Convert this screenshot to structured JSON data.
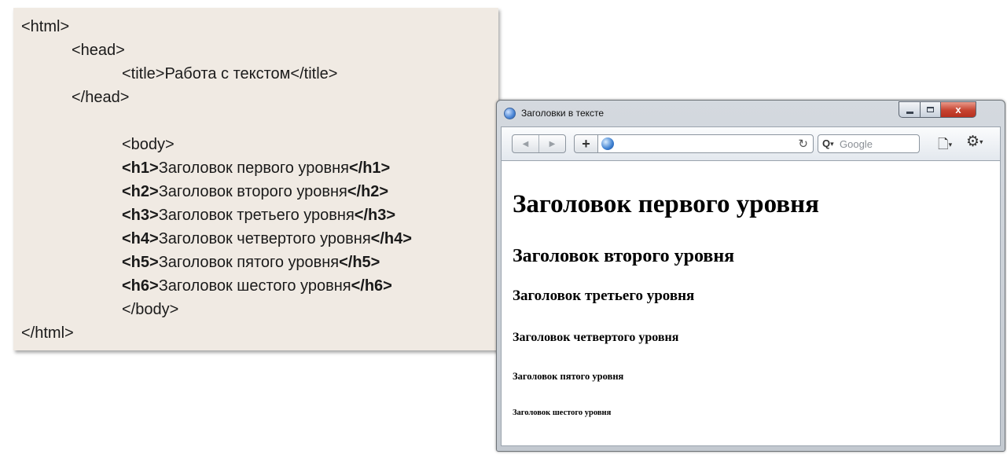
{
  "code_lines": [
    {
      "indent": 0,
      "plain": "<html>"
    },
    {
      "indent": 1,
      "plain": "<head>"
    },
    {
      "indent": 2,
      "plain": "<title>Работа с текстом</title>"
    },
    {
      "indent": 1,
      "plain": "</head>"
    },
    {
      "indent": 2,
      "plain": "<body>"
    },
    {
      "indent": 2,
      "open": "<h1>",
      "text": "Заголовок первого уровня",
      "close": "</h1>"
    },
    {
      "indent": 2,
      "open": "<h2>",
      "text": "Заголовок второго уровня",
      "close": "</h2>"
    },
    {
      "indent": 2,
      "open": "<h3>",
      "text": "Заголовок третьего уровня",
      "close": "</h3>"
    },
    {
      "indent": 2,
      "open": "<h4>",
      "text": "Заголовок четвертого уровня",
      "close": "</h4>"
    },
    {
      "indent": 2,
      "open": "<h5>",
      "text": "Заголовок пятого уровня",
      "close": "</h5>"
    },
    {
      "indent": 2,
      "open": "<h6>",
      "text": "Заголовок шестого уровня",
      "close": "</h6>"
    },
    {
      "indent": 2,
      "plain": "</body>"
    },
    {
      "indent": 0,
      "plain": "</html>"
    }
  ],
  "browser": {
    "title": "Заголовки в тексте",
    "back_icon": "◀",
    "forward_icon": "▶",
    "new_tab_icon": "+",
    "reload_icon": "↻",
    "search_placeholder": "Google",
    "search_icon": "search-icon",
    "close_glyph": "x",
    "colors": {
      "code_bg": "#f0eae3",
      "close_red": "#c64330"
    }
  },
  "page": {
    "h1": "Заголовок первого уровня",
    "h2": "Заголовок второго уровня",
    "h3": "Заголовок третьего уровня",
    "h4": "Заголовок четвертого уровня",
    "h5": "Заголовок пятого уровня",
    "h6": "Заголовок шестого уровня"
  }
}
